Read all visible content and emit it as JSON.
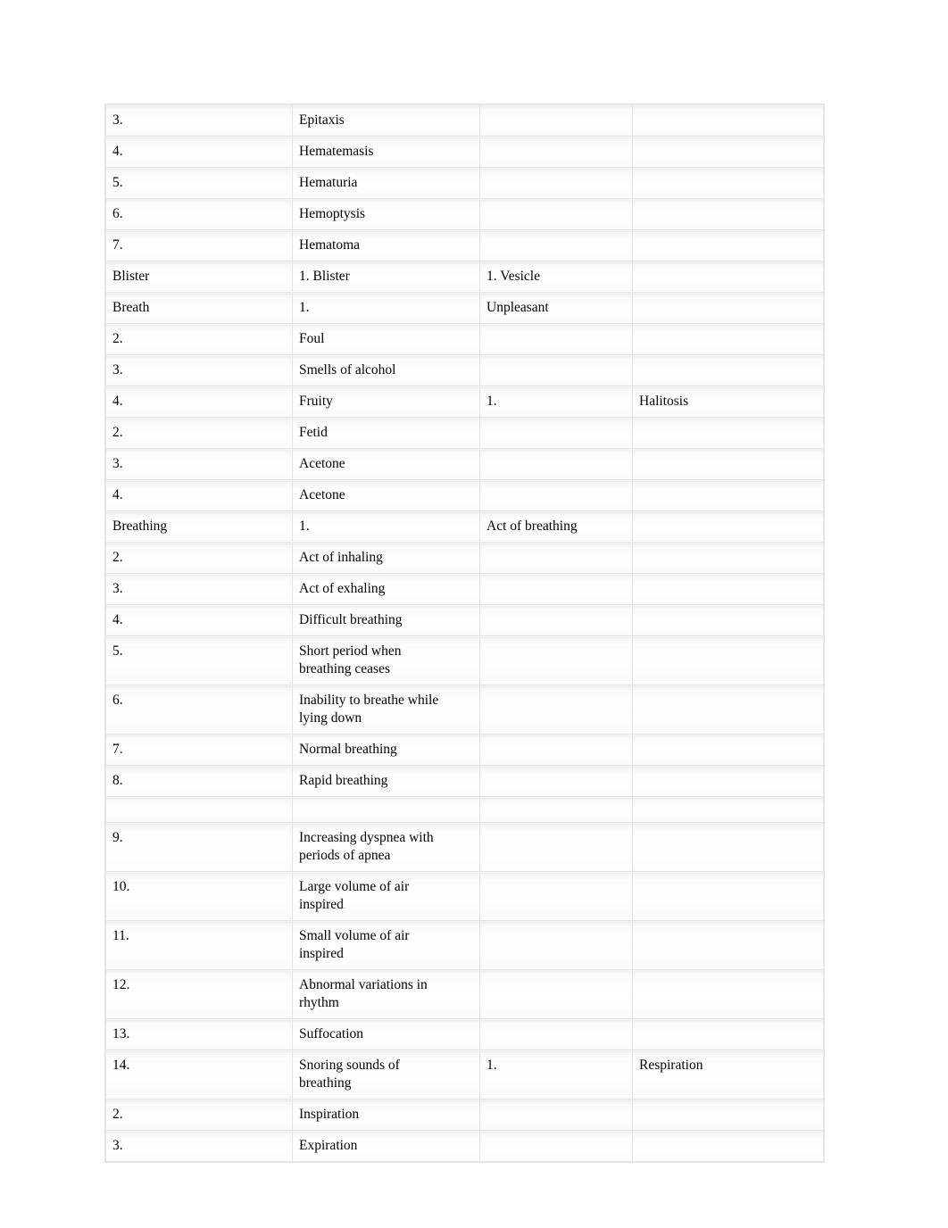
{
  "document": {
    "type": "table",
    "background_color": "#ffffff",
    "table_border_color": "#e6e6e6",
    "text_color": "#000000",
    "columns": 4,
    "column_headers": [
      "",
      "",
      "",
      ""
    ],
    "rows": [
      {
        "c1": "3.",
        "c2": "Epitaxis",
        "c3": "",
        "c4": ""
      },
      {
        "c1": "4.",
        "c2": "Hematemasis",
        "c3": "",
        "c4": ""
      },
      {
        "c1": "5.",
        "c2": "Hematuria",
        "c3": "",
        "c4": ""
      },
      {
        "c1": "6.",
        "c2": "Hemoptysis",
        "c3": "",
        "c4": ""
      },
      {
        "c1": "7.",
        "c2": "Hematoma",
        "c3": "",
        "c4": ""
      },
      {
        "c1": "Blister",
        "c2": "1. Blister",
        "c3": "1. Vesicle",
        "c4": ""
      },
      {
        "c1": "Breath",
        "c2": "1.",
        "c3": "Unpleasant",
        "c4": ""
      },
      {
        "c1": "2.",
        "c2": "Foul",
        "c3": "",
        "c4": ""
      },
      {
        "c1": "3.",
        "c2": "Smells of alcohol",
        "c3": "",
        "c4": ""
      },
      {
        "c1": "4.",
        "c2": "Fruity",
        "c3": "1.",
        "c4": "Halitosis"
      },
      {
        "c1": "2.",
        "c2": "Fetid",
        "c3": "",
        "c4": ""
      },
      {
        "c1": "3.",
        "c2": "Acetone",
        "c3": "",
        "c4": ""
      },
      {
        "c1": "4.",
        "c2": "Acetone",
        "c3": "",
        "c4": ""
      },
      {
        "c1": "Breathing",
        "c2": "1.",
        "c3": "Act of breathing",
        "c4": ""
      },
      {
        "c1": "2.",
        "c2": "Act of inhaling",
        "c3": "",
        "c4": ""
      },
      {
        "c1": "3.",
        "c2": "Act of exhaling",
        "c3": "",
        "c4": ""
      },
      {
        "c1": "4.",
        "c2": "Difficult breathing",
        "c3": "",
        "c4": ""
      },
      {
        "c1": "5.",
        "c2": "Short period when\nbreathing ceases",
        "c3": "",
        "c4": ""
      },
      {
        "c1": "6.",
        "c2": "Inability to breathe while\nlying down",
        "c3": "",
        "c4": ""
      },
      {
        "c1": "7.",
        "c2": "Normal breathing",
        "c3": "",
        "c4": ""
      },
      {
        "c1": "8.",
        "c2": "Rapid breathing",
        "c3": "",
        "c4": ""
      },
      {
        "c1": "",
        "c2": "",
        "c3": "",
        "c4": "",
        "blank": true
      },
      {
        "c1": "9.",
        "c2": "Increasing dyspnea with\nperiods of apnea",
        "c3": "",
        "c4": ""
      },
      {
        "c1": "10.",
        "c2": "Large volume of air\ninspired",
        "c3": "",
        "c4": ""
      },
      {
        "c1": "11.",
        "c2": "Small volume of air\ninspired",
        "c3": "",
        "c4": ""
      },
      {
        "c1": "12.",
        "c2": "Abnormal variations in\nrhythm",
        "c3": "",
        "c4": ""
      },
      {
        "c1": "13.",
        "c2": "Suffocation",
        "c3": "",
        "c4": ""
      },
      {
        "c1": "14.",
        "c2": "Snoring sounds of\nbreathing",
        "c3": "1.",
        "c4": "Respiration"
      },
      {
        "c1": "2.",
        "c2": "Inspiration",
        "c3": "",
        "c4": ""
      },
      {
        "c1": "3.",
        "c2": "Expiration",
        "c3": "",
        "c4": ""
      }
    ]
  }
}
